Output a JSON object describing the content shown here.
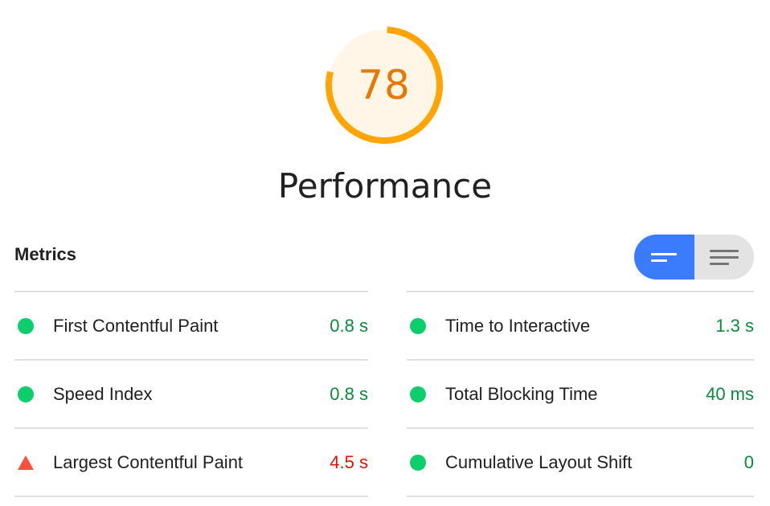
{
  "gauge": {
    "score": "78",
    "fraction": 0.78,
    "color": "#ffa400",
    "fill": "#fff6e8"
  },
  "category": {
    "title": "Performance"
  },
  "metrics_section": {
    "title": "Metrics"
  },
  "toggle": {
    "active": "collapsed-view"
  },
  "metrics": {
    "left": [
      {
        "label": "First Contentful Paint",
        "value": "0.8 s",
        "status": "pass"
      },
      {
        "label": "Speed Index",
        "value": "0.8 s",
        "status": "pass"
      },
      {
        "label": "Largest Contentful Paint",
        "value": "4.5 s",
        "status": "fail"
      }
    ],
    "right": [
      {
        "label": "Time to Interactive",
        "value": "1.3 s",
        "status": "pass"
      },
      {
        "label": "Total Blocking Time",
        "value": "40 ms",
        "status": "pass"
      },
      {
        "label": "Cumulative Layout Shift",
        "value": "0",
        "status": "pass"
      }
    ]
  },
  "colors": {
    "pass": "#0cce6b",
    "fail": "#ff4e42",
    "average": "#ffa400",
    "toggle_active": "#3b7cff"
  }
}
